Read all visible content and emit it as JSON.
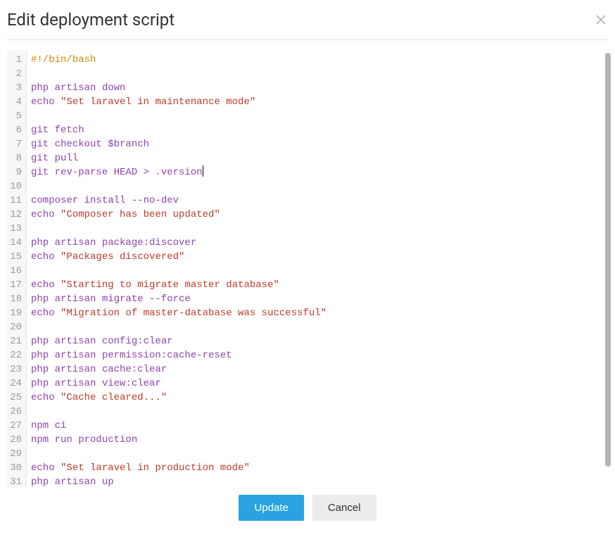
{
  "dialog": {
    "title": "Edit deployment script",
    "close_label": "Close"
  },
  "editor": {
    "cursor_line": 9,
    "cursor_after": "git rev-parse HEAD > .version",
    "lines": [
      {
        "n": 1,
        "type": "shebang",
        "text": "#!/bin/bash"
      },
      {
        "n": 2,
        "type": "blank",
        "text": ""
      },
      {
        "n": 3,
        "type": "cmd",
        "text": "php artisan down"
      },
      {
        "n": 4,
        "type": "echo",
        "cmd": "echo ",
        "str": "\"Set laravel in maintenance mode\""
      },
      {
        "n": 5,
        "type": "blank",
        "text": ""
      },
      {
        "n": 6,
        "type": "cmd",
        "text": "git fetch"
      },
      {
        "n": 7,
        "type": "cmd",
        "text": "git checkout $branch"
      },
      {
        "n": 8,
        "type": "cmd",
        "text": "git pull"
      },
      {
        "n": 9,
        "type": "cmd",
        "text": "git rev-parse HEAD > .version"
      },
      {
        "n": 10,
        "type": "blank",
        "text": ""
      },
      {
        "n": 11,
        "type": "cmd",
        "text": "composer install --no-dev"
      },
      {
        "n": 12,
        "type": "echo",
        "cmd": "echo ",
        "str": "\"Composer has been updated\""
      },
      {
        "n": 13,
        "type": "blank",
        "text": ""
      },
      {
        "n": 14,
        "type": "cmd",
        "text": "php artisan package:discover"
      },
      {
        "n": 15,
        "type": "echo",
        "cmd": "echo ",
        "str": "\"Packages discovered\""
      },
      {
        "n": 16,
        "type": "blank",
        "text": ""
      },
      {
        "n": 17,
        "type": "echo",
        "cmd": "echo ",
        "str": "\"Starting to migrate master database\""
      },
      {
        "n": 18,
        "type": "cmd",
        "text": "php artisan migrate --force"
      },
      {
        "n": 19,
        "type": "echo",
        "cmd": "echo ",
        "str": "\"Migration of master-database was successful\""
      },
      {
        "n": 20,
        "type": "blank",
        "text": ""
      },
      {
        "n": 21,
        "type": "cmd",
        "text": "php artisan config:clear"
      },
      {
        "n": 22,
        "type": "cmd",
        "text": "php artisan permission:cache-reset"
      },
      {
        "n": 23,
        "type": "cmd",
        "text": "php artisan cache:clear"
      },
      {
        "n": 24,
        "type": "cmd",
        "text": "php artisan view:clear"
      },
      {
        "n": 25,
        "type": "echo",
        "cmd": "echo ",
        "str": "\"Cache cleared...\""
      },
      {
        "n": 26,
        "type": "blank",
        "text": ""
      },
      {
        "n": 27,
        "type": "cmd",
        "text": "npm ci"
      },
      {
        "n": 28,
        "type": "cmd",
        "text": "npm run production"
      },
      {
        "n": 29,
        "type": "blank",
        "text": ""
      },
      {
        "n": 30,
        "type": "echo",
        "cmd": "echo ",
        "str": "\"Set laravel in production mode\""
      },
      {
        "n": 31,
        "type": "cmd",
        "text": "php artisan up"
      }
    ]
  },
  "buttons": {
    "primary": "Update",
    "secondary": "Cancel"
  }
}
